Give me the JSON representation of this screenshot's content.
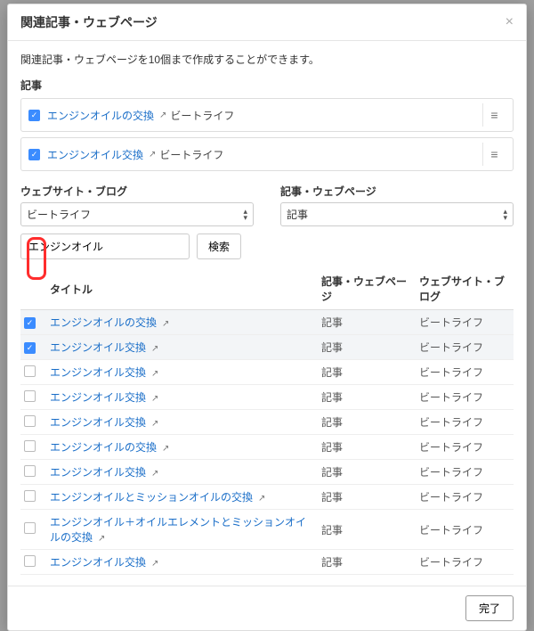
{
  "modal": {
    "title": "関連記事・ウェブページ",
    "hint": "関連記事・ウェブページを10個まで作成することができます。",
    "close_glyph": "×"
  },
  "selected_section": {
    "label": "記事",
    "items": [
      {
        "title": "エンジンオイルの交換",
        "crumb": "ビートライフ"
      },
      {
        "title": "エンジンオイル交換",
        "crumb": "ビートライフ"
      }
    ]
  },
  "filters": {
    "site_label": "ウェブサイト・ブログ",
    "site_value": "ビートライフ",
    "type_label": "記事・ウェブページ",
    "type_value": "記事"
  },
  "search": {
    "value": "エンジンオイル",
    "button": "検索"
  },
  "table": {
    "columns": {
      "title": "タイトル",
      "type": "記事・ウェブページ",
      "site": "ウェブサイト・ブログ"
    },
    "rows": [
      {
        "checked": true,
        "title": "エンジンオイルの交換",
        "type": "記事",
        "site": "ビートライフ"
      },
      {
        "checked": true,
        "title": "エンジンオイル交換",
        "type": "記事",
        "site": "ビートライフ"
      },
      {
        "checked": false,
        "title": "エンジンオイル交換",
        "type": "記事",
        "site": "ビートライフ"
      },
      {
        "checked": false,
        "title": "エンジンオイル交換",
        "type": "記事",
        "site": "ビートライフ"
      },
      {
        "checked": false,
        "title": "エンジンオイル交換",
        "type": "記事",
        "site": "ビートライフ"
      },
      {
        "checked": false,
        "title": "エンジンオイルの交換",
        "type": "記事",
        "site": "ビートライフ"
      },
      {
        "checked": false,
        "title": "エンジンオイル交換",
        "type": "記事",
        "site": "ビートライフ"
      },
      {
        "checked": false,
        "title": "エンジンオイルとミッションオイルの交換",
        "type": "記事",
        "site": "ビートライフ"
      },
      {
        "checked": false,
        "title": "エンジンオイル＋オイルエレメントとミッションオイルの交換",
        "type": "記事",
        "site": "ビートライフ"
      },
      {
        "checked": false,
        "title": "エンジンオイル交換",
        "type": "記事",
        "site": "ビートライフ"
      }
    ]
  },
  "footer": {
    "done": "完了"
  },
  "glyphs": {
    "check": "✓",
    "external": "↗",
    "drag": "≡"
  }
}
